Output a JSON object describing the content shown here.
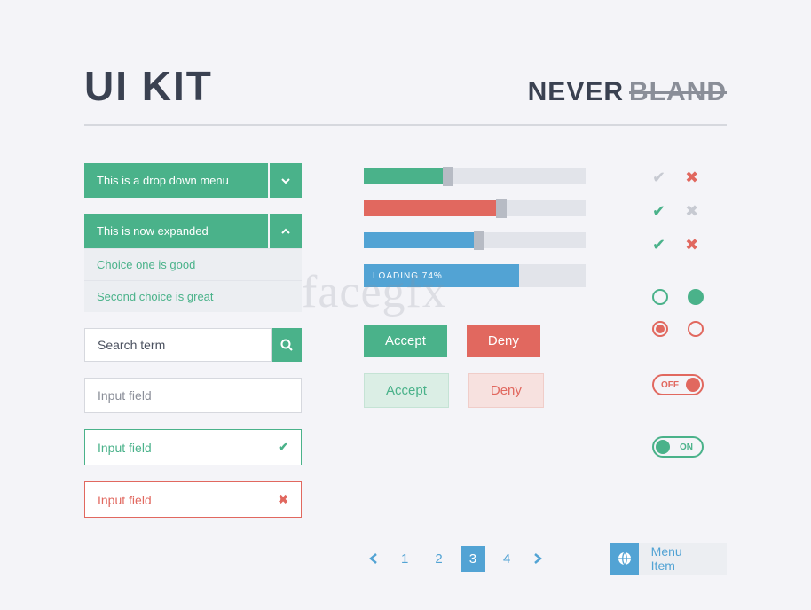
{
  "header": {
    "title": "UI KIT",
    "brand_a": "NEVER",
    "brand_b": "BLAND"
  },
  "dropdown_closed": {
    "label": "This is a drop down menu"
  },
  "dropdown_open": {
    "label": "This is now expanded",
    "options": [
      "Choice one is good",
      "Second choice is great"
    ]
  },
  "search": {
    "value": "Search term"
  },
  "inputs": {
    "plain": "Input field",
    "valid": "Input field",
    "error": "Input field"
  },
  "sliders": {
    "green_pct": 38,
    "red_pct": 62,
    "blue_pct": 52
  },
  "progress": {
    "pct": 74,
    "label": "LOADING 74%"
  },
  "buttons": {
    "accept": "Accept",
    "deny": "Deny"
  },
  "toggles": {
    "off": "OFF",
    "on": "ON"
  },
  "pager": {
    "pages": [
      "1",
      "2",
      "3",
      "4"
    ],
    "active": "3"
  },
  "menu_item": {
    "label": "Menu Item"
  },
  "watermark": "facegfx"
}
